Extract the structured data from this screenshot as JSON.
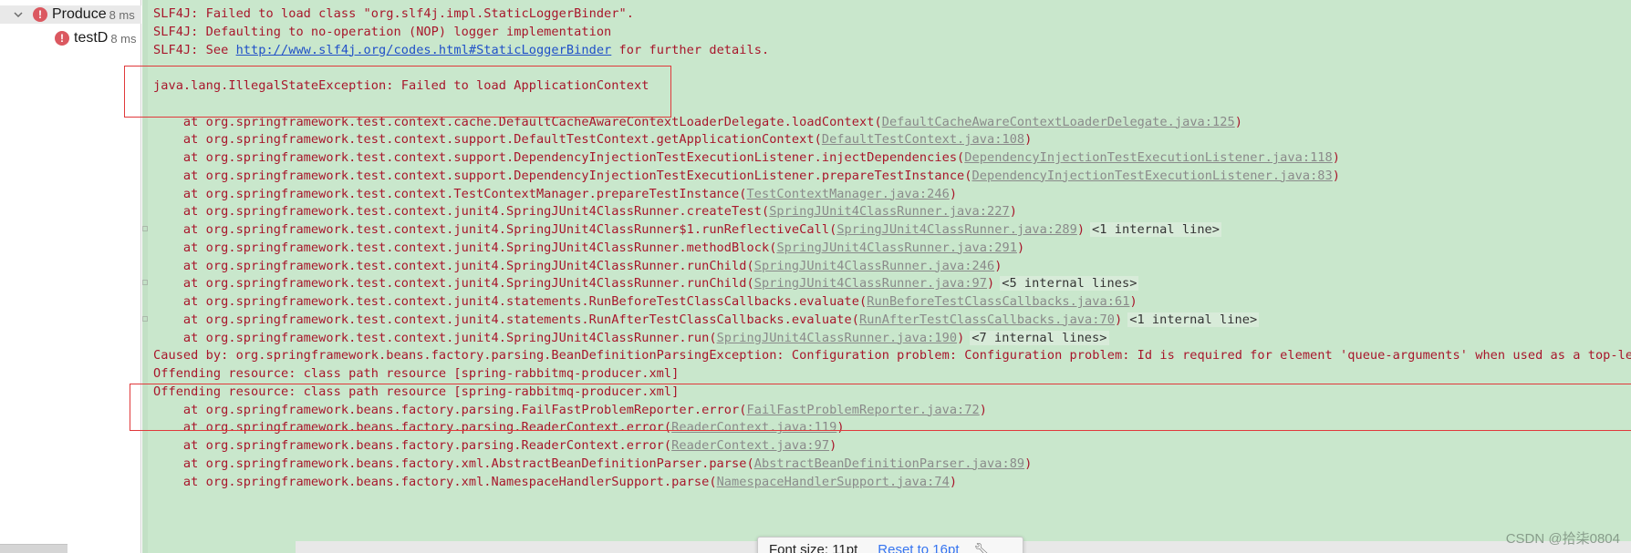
{
  "tree": {
    "items": [
      {
        "name": "Produce",
        "time": "8 ms",
        "status": "error"
      },
      {
        "name": "testD",
        "time": "8 ms",
        "status": "error"
      }
    ]
  },
  "console": {
    "lines": [
      {
        "parts": [
          {
            "t": "SLF4J: Failed to load class \"org.slf4j.impl.StaticLoggerBinder\"."
          }
        ]
      },
      {
        "parts": [
          {
            "t": "SLF4J: Defaulting to no-operation (NOP) logger implementation"
          }
        ]
      },
      {
        "parts": [
          {
            "t": "SLF4J: See "
          },
          {
            "t": "http://www.slf4j.org/codes.html#StaticLoggerBinder",
            "k": "url"
          },
          {
            "t": " for further details."
          }
        ]
      },
      {
        "parts": [
          {
            "t": ""
          }
        ]
      },
      {
        "parts": [
          {
            "t": "java.lang.IllegalStateException: Failed to load ApplicationContext"
          }
        ]
      },
      {
        "parts": [
          {
            "t": ""
          }
        ]
      },
      {
        "parts": [
          {
            "t": "    at org.springframework.test.context.cache.DefaultCacheAwareContextLoaderDelegate.loadContext("
          },
          {
            "t": "DefaultCacheAwareContextLoaderDelegate.java:125",
            "k": "link"
          },
          {
            "t": ")"
          }
        ]
      },
      {
        "parts": [
          {
            "t": "    at org.springframework.test.context.support.DefaultTestContext.getApplicationContext("
          },
          {
            "t": "DefaultTestContext.java:108",
            "k": "link"
          },
          {
            "t": ")"
          }
        ]
      },
      {
        "parts": [
          {
            "t": "    at org.springframework.test.context.support.DependencyInjectionTestExecutionListener.injectDependencies("
          },
          {
            "t": "DependencyInjectionTestExecutionListener.java:118",
            "k": "link"
          },
          {
            "t": ")"
          }
        ]
      },
      {
        "parts": [
          {
            "t": "    at org.springframework.test.context.support.DependencyInjectionTestExecutionListener.prepareTestInstance("
          },
          {
            "t": "DependencyInjectionTestExecutionListener.java:83",
            "k": "link"
          },
          {
            "t": ")"
          }
        ]
      },
      {
        "parts": [
          {
            "t": "    at org.springframework.test.context.TestContextManager.prepareTestInstance("
          },
          {
            "t": "TestContextManager.java:246",
            "k": "link"
          },
          {
            "t": ")"
          }
        ]
      },
      {
        "parts": [
          {
            "t": "    at org.springframework.test.context.junit4.SpringJUnit4ClassRunner.createTest("
          },
          {
            "t": "SpringJUnit4ClassRunner.java:227",
            "k": "link"
          },
          {
            "t": ")"
          }
        ]
      },
      {
        "fold": true,
        "parts": [
          {
            "t": "    at org.springframework.test.context.junit4.SpringJUnit4ClassRunner$1.runReflectiveCall("
          },
          {
            "t": "SpringJUnit4ClassRunner.java:289",
            "k": "link"
          },
          {
            "t": ")"
          },
          {
            "t": "<1 internal line>",
            "k": "fold"
          }
        ]
      },
      {
        "parts": [
          {
            "t": "    at org.springframework.test.context.junit4.SpringJUnit4ClassRunner.methodBlock("
          },
          {
            "t": "SpringJUnit4ClassRunner.java:291",
            "k": "link"
          },
          {
            "t": ")"
          }
        ]
      },
      {
        "parts": [
          {
            "t": "    at org.springframework.test.context.junit4.SpringJUnit4ClassRunner.runChild("
          },
          {
            "t": "SpringJUnit4ClassRunner.java:246",
            "k": "link"
          },
          {
            "t": ")"
          }
        ]
      },
      {
        "fold": true,
        "parts": [
          {
            "t": "    at org.springframework.test.context.junit4.SpringJUnit4ClassRunner.runChild("
          },
          {
            "t": "SpringJUnit4ClassRunner.java:97",
            "k": "link"
          },
          {
            "t": ")"
          },
          {
            "t": "<5 internal lines>",
            "k": "fold"
          }
        ]
      },
      {
        "parts": [
          {
            "t": "    at org.springframework.test.context.junit4.statements.RunBeforeTestClassCallbacks.evaluate("
          },
          {
            "t": "RunBeforeTestClassCallbacks.java:61",
            "k": "link"
          },
          {
            "t": ")"
          }
        ]
      },
      {
        "fold": true,
        "parts": [
          {
            "t": "    at org.springframework.test.context.junit4.statements.RunAfterTestClassCallbacks.evaluate("
          },
          {
            "t": "RunAfterTestClassCallbacks.java:70",
            "k": "link"
          },
          {
            "t": ")"
          },
          {
            "t": "<1 internal line>",
            "k": "fold"
          }
        ]
      },
      {
        "parts": [
          {
            "t": "    at org.springframework.test.context.junit4.SpringJUnit4ClassRunner.run("
          },
          {
            "t": "SpringJUnit4ClassRunner.java:190",
            "k": "link"
          },
          {
            "t": ")"
          },
          {
            "t": "<7 internal lines>",
            "k": "fold"
          }
        ]
      },
      {
        "parts": [
          {
            "t": "Caused by: org.springframework.beans.factory.parsing.BeanDefinitionParsingException: Configuration problem: Configuration problem: Id is required for element 'queue-arguments' when used as a top-level tag"
          }
        ]
      },
      {
        "parts": [
          {
            "t": "Offending resource: class path resource [spring-rabbitmq-producer.xml]"
          }
        ]
      },
      {
        "parts": [
          {
            "t": "Offending resource: class path resource [spring-rabbitmq-producer.xml]"
          }
        ]
      },
      {
        "parts": [
          {
            "t": "    at org.springframework.beans.factory.parsing.FailFastProblemReporter.error("
          },
          {
            "t": "FailFastProblemReporter.java:72",
            "k": "link"
          },
          {
            "t": ")"
          }
        ]
      },
      {
        "parts": [
          {
            "t": "    at org.springframework.beans.factory.parsing.ReaderContext.error("
          },
          {
            "t": "ReaderContext.java:119",
            "k": "link"
          },
          {
            "t": ")"
          }
        ]
      },
      {
        "parts": [
          {
            "t": "    at org.springframework.beans.factory.parsing.ReaderContext.error("
          },
          {
            "t": "ReaderContext.java:97",
            "k": "link"
          },
          {
            "t": ")"
          }
        ]
      },
      {
        "parts": [
          {
            "t": "    at org.springframework.beans.factory.xml.AbstractBeanDefinitionParser.parse("
          },
          {
            "t": "AbstractBeanDefinitionParser.java:89",
            "k": "link"
          },
          {
            "t": ")"
          }
        ]
      },
      {
        "parts": [
          {
            "t": "    at org.springframework.beans.factory.xml.NamespaceHandlerSupport.parse("
          },
          {
            "t": "NamespaceHandlerSupport.java:74",
            "k": "link"
          },
          {
            "t": ")"
          }
        ]
      }
    ]
  },
  "popup": {
    "font_size_label": "Font size: 11pt",
    "reset_label": "Reset to 16pt",
    "settings_icon": "wrench-icon"
  },
  "watermark": "CSDN @拾柒0804",
  "colors": {
    "console_bg": "#c9e7cc",
    "error_text": "#a8162b",
    "link": "#8a8a8a",
    "url": "#2050c8",
    "highlight_box": "#e0393b"
  }
}
